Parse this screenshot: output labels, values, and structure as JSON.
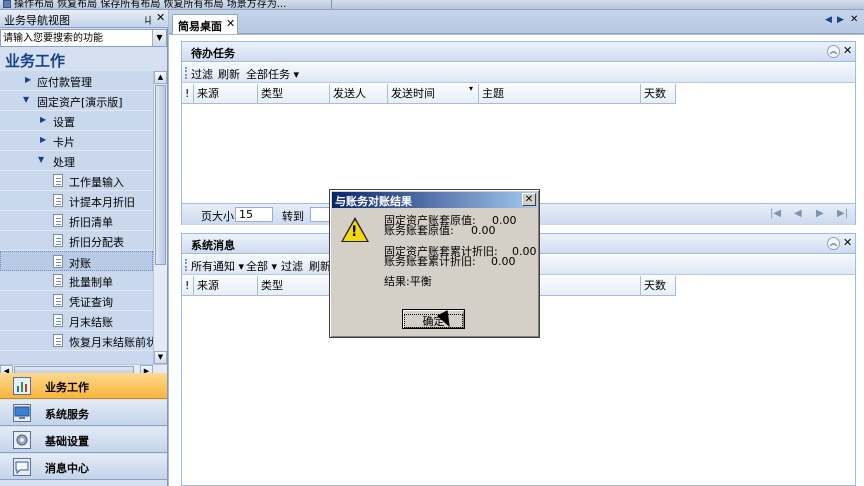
{
  "topbar": {
    "menu_text": "操作布局 恢复布局 保存所有布局 恢复所有布局 场景方存为..."
  },
  "sidebar": {
    "title": "业务导航视图",
    "pin_glyph": "ㄐ",
    "close_glyph": "✕",
    "search_placeholder": "请输入您要搜索的功能",
    "section_title": "业务工作",
    "tree": [
      {
        "label": "应付款管理",
        "arrow": "▶"
      },
      {
        "label": "固定资产[演示版]",
        "arrow": "▼"
      },
      {
        "label": "设置",
        "arrow": "▶"
      },
      {
        "label": "卡片",
        "arrow": "▶"
      },
      {
        "label": "处理",
        "arrow": "▼"
      },
      {
        "label": "工作量输入"
      },
      {
        "label": "计提本月折旧"
      },
      {
        "label": "折旧清单"
      },
      {
        "label": "折旧分配表"
      },
      {
        "label": "对账"
      },
      {
        "label": "批量制单"
      },
      {
        "label": "凭证查询"
      },
      {
        "label": "月末结账"
      },
      {
        "label": "恢复月末结账前状态"
      }
    ],
    "nav_buttons": [
      {
        "label": "业务工作"
      },
      {
        "label": "系统服务"
      },
      {
        "label": "基础设置"
      },
      {
        "label": "消息中心"
      }
    ]
  },
  "tabs": {
    "active_label": "简易桌面",
    "close_glyph": "✕",
    "nav_left": "◀",
    "nav_right": "▶",
    "nav_close": "✕"
  },
  "todo_panel": {
    "title": "待办任务",
    "collapse_glyph": "︽",
    "close_glyph": "✕",
    "toolbar": {
      "filter": "过滤",
      "refresh": "刷新",
      "all_tasks": "全部任务 ▾"
    },
    "columns": [
      "!",
      "来源",
      "类型",
      "发送人",
      "发送时间",
      "主题",
      "天数"
    ],
    "sort_glyph": "▾",
    "pager": {
      "page_size_label": "页大小",
      "page_size": "15",
      "goto_label": "转到"
    },
    "pager_nav": [
      "|◀",
      "◀",
      "▶",
      "▶|"
    ]
  },
  "message_panel": {
    "title": "系统消息",
    "collapse_glyph": "︽",
    "close_glyph": "✕",
    "toolbar": {
      "all_notice": "所有通知 ▾",
      "all": "全部 ▾",
      "filter": "过滤",
      "refresh": "刷新"
    },
    "columns": [
      "!",
      "来源",
      "类型",
      "",
      "",
      "",
      "天数"
    ]
  },
  "dialog": {
    "title": "与账务对账结果",
    "close_glyph": "✕",
    "warn_mark": "!",
    "lines": [
      {
        "label": "固定资产账套原值:",
        "value": "0.00"
      },
      {
        "label": "账务账套原值:",
        "value": "0.00"
      },
      {
        "label": "固定资产账套累计折旧:",
        "value": "0.00"
      },
      {
        "label": "账务账套累计折旧:",
        "value": "0.00"
      }
    ],
    "result": "结果:平衡",
    "ok_label": "确定"
  }
}
